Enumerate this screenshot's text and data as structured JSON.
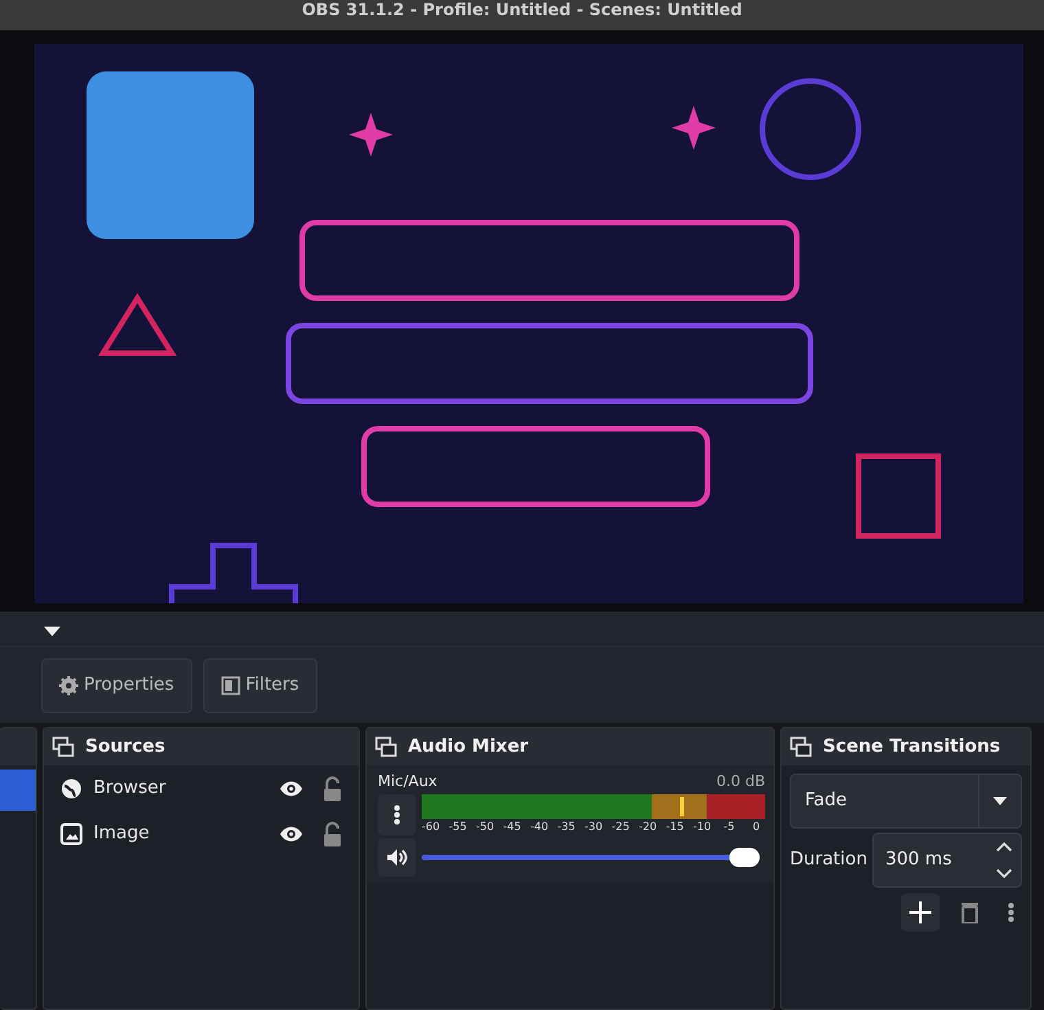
{
  "window": {
    "title": "OBS 31.1.2 - Profile: Untitled - Scenes: Untitled"
  },
  "toolbar": [
    {
      "label": "Properties",
      "kind": "properties"
    },
    {
      "label": "Filters",
      "kind": "filters"
    }
  ],
  "scenes": {
    "items": [
      {
        "selected": true
      }
    ]
  },
  "sources": {
    "title": "Sources",
    "items": [
      {
        "label": "Browser",
        "kind": "browser",
        "visible": true,
        "locked": false
      },
      {
        "label": "Image",
        "kind": "image",
        "visible": true,
        "locked": false
      }
    ]
  },
  "audio_mixer": {
    "title": "Audio Mixer",
    "channels": [
      {
        "name": "Mic/Aux",
        "reading": "0.0 dB",
        "meter": {
          "level": 0.75
        },
        "ticks": [
          "-60",
          "-55",
          "-50",
          "-45",
          "-40",
          "-35",
          "-30",
          "-25",
          "-20",
          "-15",
          "-10",
          "-5",
          "0"
        ],
        "volume": {
          "level": 1
        },
        "muted": false
      }
    ]
  },
  "scene_transitions": {
    "title": "Scene Transitions",
    "transition": "Fade",
    "duration_label": "Duration",
    "duration": "300 ms"
  }
}
